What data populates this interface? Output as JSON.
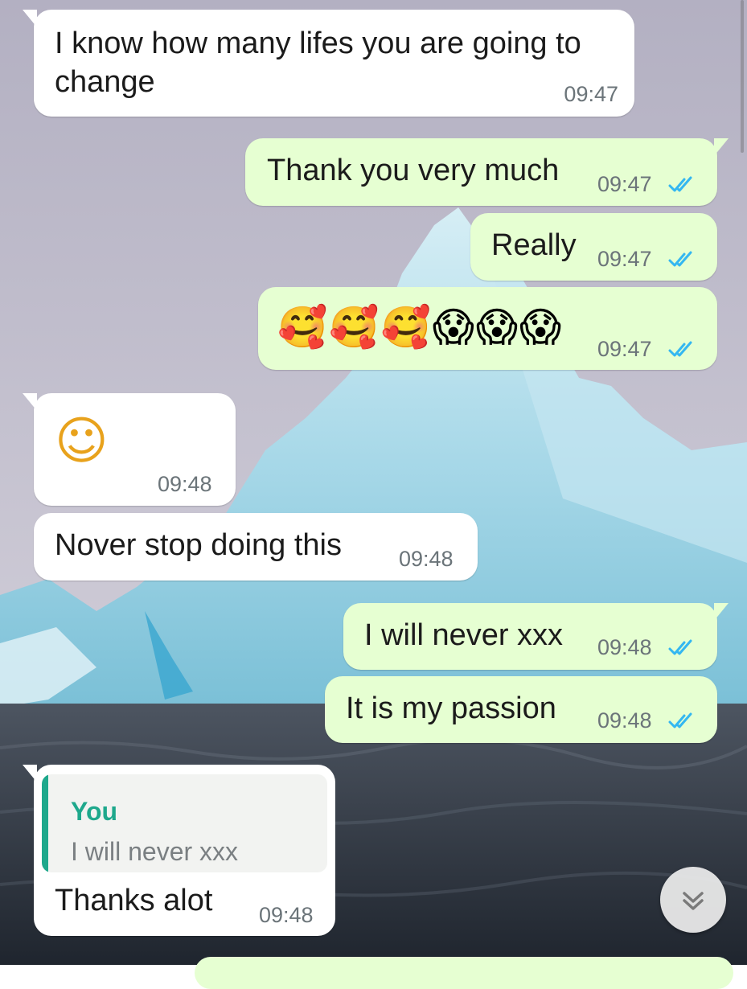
{
  "chat": {
    "messages": [
      {
        "direction": "incoming",
        "text": "I know how many lifes you are going to change",
        "time": "09:47"
      },
      {
        "direction": "outgoing",
        "text": "Thank you very much",
        "time": "09:47",
        "status": "read"
      },
      {
        "direction": "outgoing",
        "text": "Really",
        "time": "09:47",
        "status": "read"
      },
      {
        "direction": "outgoing",
        "emojis": [
          "smiling-face-with-hearts",
          "smiling-face-with-hearts",
          "smiling-face-with-hearts",
          "face-screaming-in-fear",
          "face-screaming-in-fear",
          "face-screaming-in-fear"
        ],
        "emoji_text": "🥰🥰🥰😱😱😱",
        "time": "09:47",
        "status": "read"
      },
      {
        "direction": "incoming",
        "emojis": [
          "smiling-face-with-smiling-eyes"
        ],
        "emoji_text": "☺",
        "time": "09:48"
      },
      {
        "direction": "incoming",
        "text": "Nover stop doing this",
        "time": "09:48"
      },
      {
        "direction": "outgoing",
        "text": "I will never xxx",
        "time": "09:48",
        "status": "read"
      },
      {
        "direction": "outgoing",
        "text": "It is my passion",
        "time": "09:48",
        "status": "read"
      },
      {
        "direction": "incoming",
        "quote": {
          "author": "You",
          "text": "I will never xxx"
        },
        "text": "Thanks alot",
        "time": "09:48"
      }
    ]
  },
  "colors": {
    "incoming_bubble": "#ffffff",
    "outgoing_bubble": "#e6ffd2",
    "read_ticks": "#34b7f1",
    "quote_accent": "#1ea88c",
    "timestamp": "#6b7479"
  },
  "icons": {
    "read_receipt": "double-check-icon",
    "scroll_down": "double-chevron-down-icon"
  }
}
